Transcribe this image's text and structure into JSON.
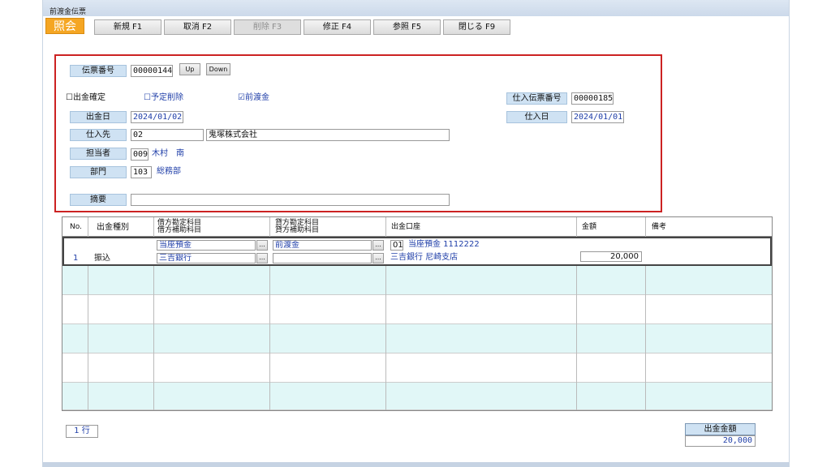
{
  "window": {
    "title": "前渡金伝票"
  },
  "mode": "照会",
  "toolbar": {
    "new": "新規 F1",
    "cancel": "取消 F2",
    "delete": "削除 F3",
    "modify": "修正 F4",
    "reference": "参照 F5",
    "close": "閉じる F9"
  },
  "header": {
    "voucher_no_label": "伝票番号",
    "voucher_no": "00000144",
    "up": "Up",
    "down": "Down",
    "payment_confirmed": "☐出金確定",
    "scheduled_delete": "☐予定削除",
    "advance": "☑前渡金",
    "purchase_voucher_label": "仕入伝票番号",
    "purchase_voucher_no": "00000185",
    "payment_date_label": "出金日",
    "payment_date": "2024/01/02",
    "purchase_date_label": "仕入日",
    "purchase_date": "2024/01/01",
    "supplier_label": "仕入先",
    "supplier_code": "02",
    "supplier_name": "鬼塚株式会社",
    "staff_label": "担当者",
    "staff_code": "009",
    "staff_name": "木村　南",
    "dept_label": "部門",
    "dept_code": "103",
    "dept_name": "総務部",
    "memo_label": "摘要",
    "memo": ""
  },
  "grid": {
    "columns": {
      "no": "No.",
      "type": "出金種別",
      "debit1": "借方勘定科目",
      "debit2": "借方補助科目",
      "credit1": "貸方勘定科目",
      "credit2": "貸方補助科目",
      "account": "出金口座",
      "amount": "金額",
      "note": "備考"
    },
    "row1": {
      "no": "1",
      "type": "振込",
      "debit_account": "当座預金",
      "debit_sub": "三吉銀行",
      "credit_account": "前渡金",
      "credit_sub": "",
      "account_code": "01",
      "account_name": "当座預金 1112222",
      "bank": "三吉銀行 尼崎支店",
      "amount": "20,000",
      "dots": "..."
    }
  },
  "footer": {
    "row_count": "1 行",
    "total_label": "出金金額",
    "total": "20,000"
  }
}
